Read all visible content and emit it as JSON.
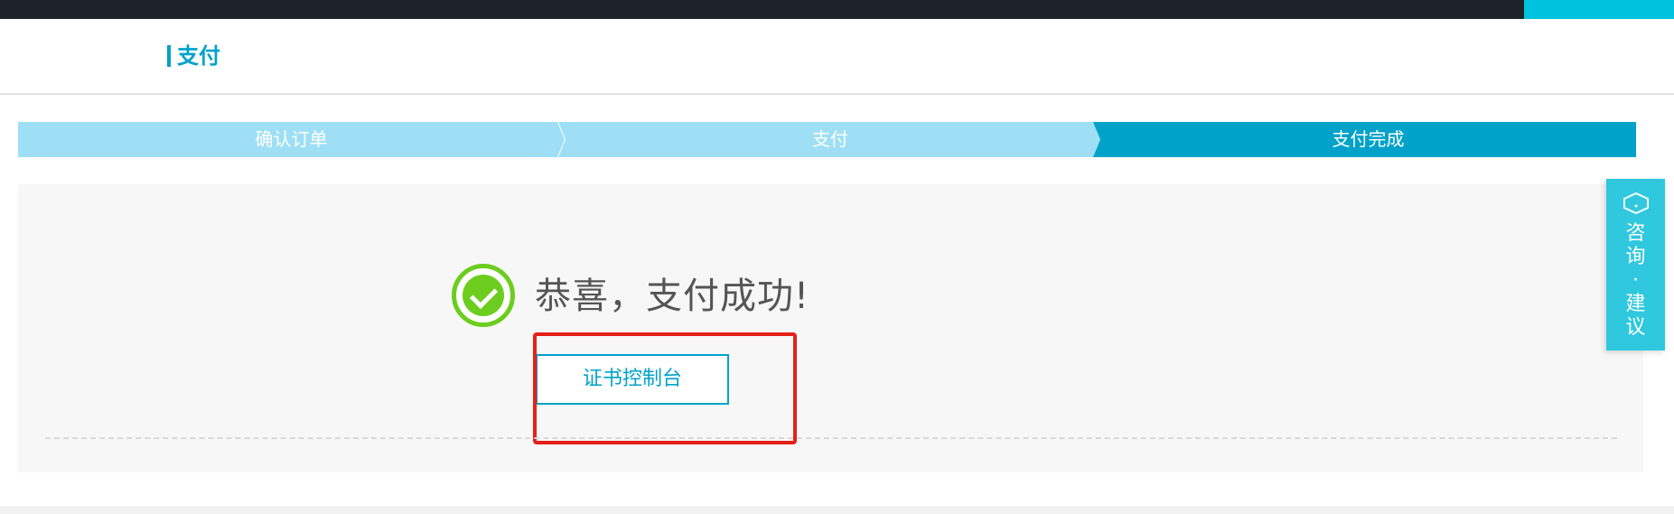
{
  "header": {
    "title": "支付"
  },
  "steps": [
    {
      "label": "确认订单"
    },
    {
      "label": "支付"
    },
    {
      "label": "支付完成"
    }
  ],
  "result": {
    "message": "恭喜，支付成功!",
    "button_label": "证书控制台"
  },
  "floating": {
    "chars": [
      "咨",
      "询",
      "·",
      "建",
      "议"
    ],
    "icon": "hexagon-icon"
  },
  "colors": {
    "accent": "#00a2ca",
    "step_inactive": "#9fdff5",
    "success": "#6ccd1e",
    "highlight": "#e52019",
    "float": "#2fc8de"
  }
}
